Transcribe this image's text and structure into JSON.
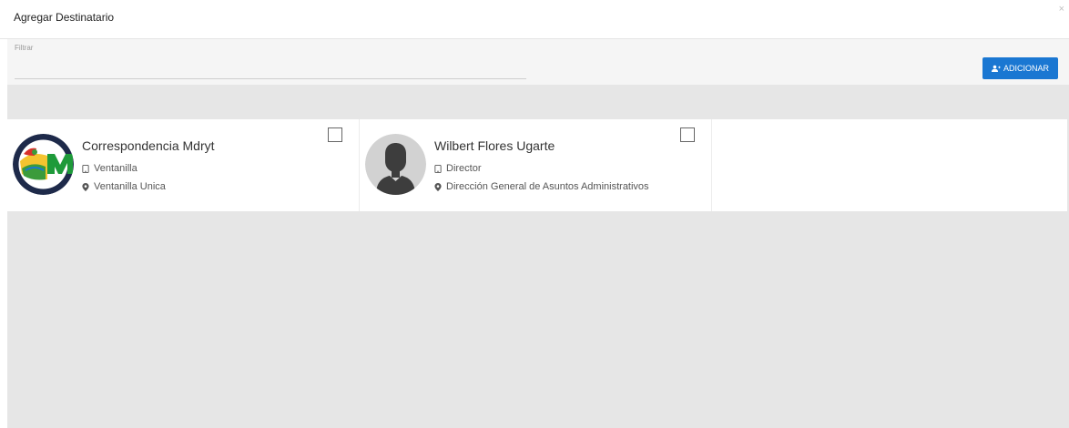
{
  "modal": {
    "title": "Agregar Destinatario",
    "close_label": "×"
  },
  "filter": {
    "label": "Filtrar",
    "value": "",
    "placeholder": ""
  },
  "actions": {
    "add_label": "ADICIONAR",
    "add_icon": "user-plus-icon",
    "accent": "#1a77d2"
  },
  "recipients": [
    {
      "name": "Correspondencia Mdryt",
      "role": "Ventanilla",
      "location": "Ventanilla Unica",
      "avatar": "mdryt-logo",
      "checked": false
    },
    {
      "name": "Wilbert Flores Ugarte",
      "role": "Director",
      "location": "Dirección General de Asuntos Administrativos",
      "avatar": "default-user-avatar",
      "checked": false
    }
  ],
  "icons": {
    "role": "mobile-icon",
    "location": "map-marker-icon"
  }
}
